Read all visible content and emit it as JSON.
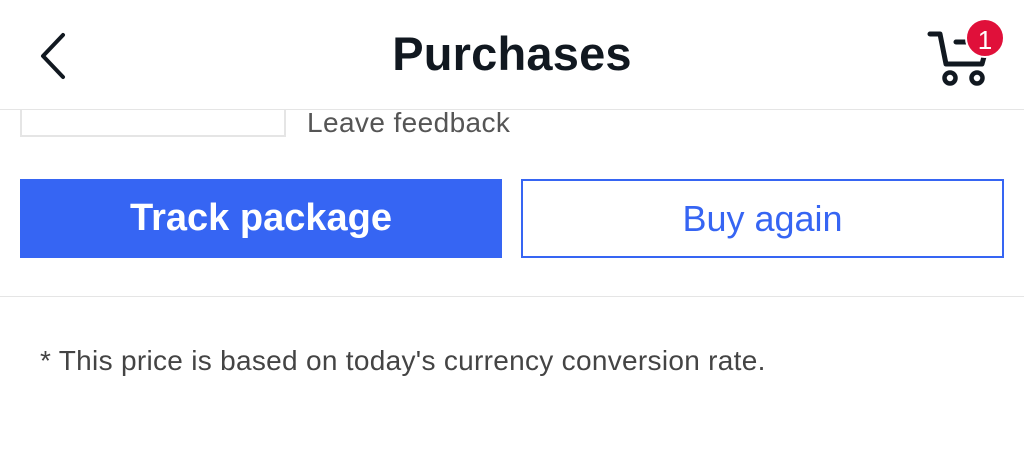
{
  "header": {
    "title": "Purchases",
    "back_icon": "chevron-left-icon",
    "cart_icon": "shopping-cart-icon",
    "cart_count": "1",
    "badge_color": "#e0103a"
  },
  "order": {
    "feedback_label": "Leave feedback"
  },
  "actions": {
    "track_label": "Track package",
    "buy_again_label": "Buy again",
    "primary_color": "#3665f3"
  },
  "footer": {
    "note": "* This price is based on today's currency conversion rate."
  }
}
